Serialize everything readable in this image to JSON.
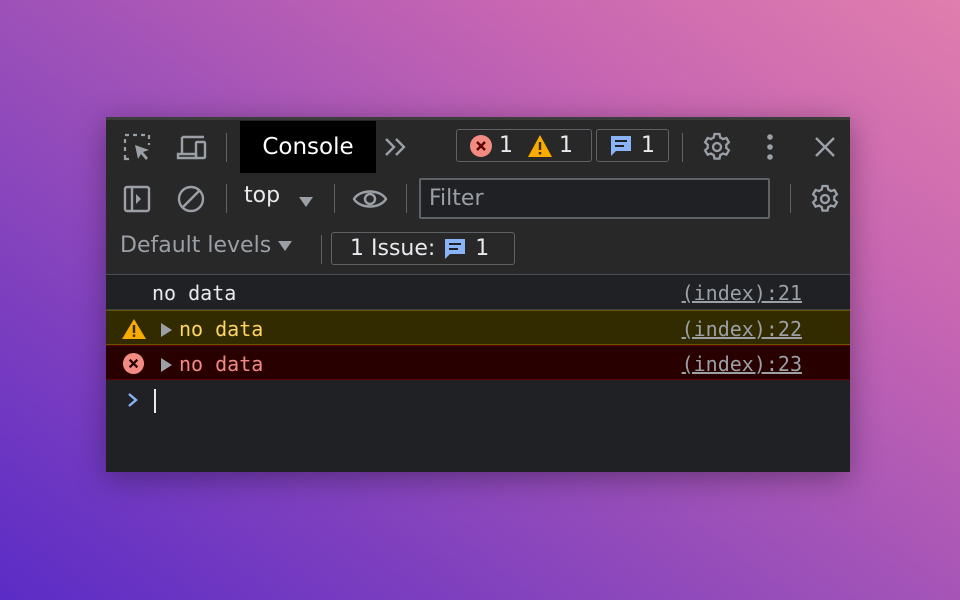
{
  "tabs": {
    "active": "Console",
    "more": "»"
  },
  "counters": {
    "errors": "1",
    "warnings": "1",
    "messages": "1"
  },
  "filterbar": {
    "context": "top",
    "filter_placeholder": "Filter",
    "levels_label": "Default levels",
    "issues_label": "1 Issue:",
    "issues_count": "1"
  },
  "logs": [
    {
      "level": "info",
      "text": "no data",
      "source": "(index):21"
    },
    {
      "level": "warning",
      "text": "no data",
      "source": "(index):22"
    },
    {
      "level": "error",
      "text": "no data",
      "source": "(index):23"
    }
  ],
  "colors": {
    "panel_bg": "#202124",
    "toolbar_bg": "#282828",
    "warning_bg": "#332b00",
    "warning_text": "#fdd663",
    "error_bg": "#290000",
    "error_text": "#f28b82",
    "accent_blue": "#8ab4f8",
    "error_icon": "#f28b82",
    "warning_icon": "#f9ab00"
  },
  "icons": [
    "inspect-element-icon",
    "device-toolbar-icon",
    "more-tabs-icon",
    "error-icon",
    "warning-icon",
    "message-icon",
    "gear-icon",
    "kebab-menu-icon",
    "close-icon",
    "sidebar-toggle-icon",
    "clear-console-icon",
    "dropdown-arrow-icon",
    "eye-icon",
    "expand-triangle-icon",
    "prompt-chevron-icon"
  ]
}
